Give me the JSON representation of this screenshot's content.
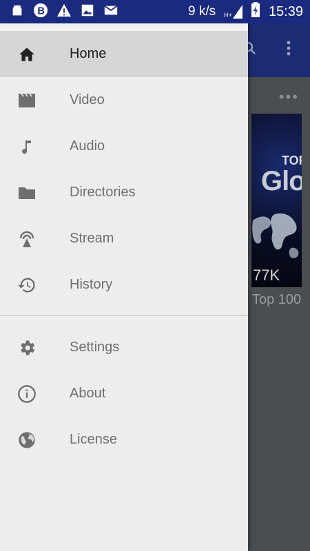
{
  "status_bar": {
    "speed": "9 k/s",
    "network": "H+",
    "time": "15:39",
    "icons": [
      "android-icon",
      "b-icon",
      "warning-icon",
      "image-icon",
      "mail-icon",
      "signal-icon",
      "battery-icon"
    ]
  },
  "background": {
    "more_label": "•••",
    "card_top_text": "TOP",
    "card_big_text": "Glo",
    "card_views": "77K",
    "card_title": "Top 100"
  },
  "drawer": {
    "items": [
      {
        "label": "Home",
        "icon": "home-icon"
      },
      {
        "label": "Video",
        "icon": "video-icon"
      },
      {
        "label": "Audio",
        "icon": "music-note-icon"
      },
      {
        "label": "Directories",
        "icon": "folder-icon"
      },
      {
        "label": "Stream",
        "icon": "stream-antenna-icon"
      },
      {
        "label": "History",
        "icon": "history-icon"
      }
    ],
    "secondary_items": [
      {
        "label": "Settings",
        "icon": "gear-icon"
      },
      {
        "label": "About",
        "icon": "info-icon"
      },
      {
        "label": "License",
        "icon": "globe-icon"
      }
    ]
  },
  "colors": {
    "status_bar": "#1a2a7e",
    "drawer_bg": "#ededed",
    "active_item_bg": "#d6d6d6",
    "icon_active": "#222222",
    "icon_inactive": "#6f6f6f"
  }
}
